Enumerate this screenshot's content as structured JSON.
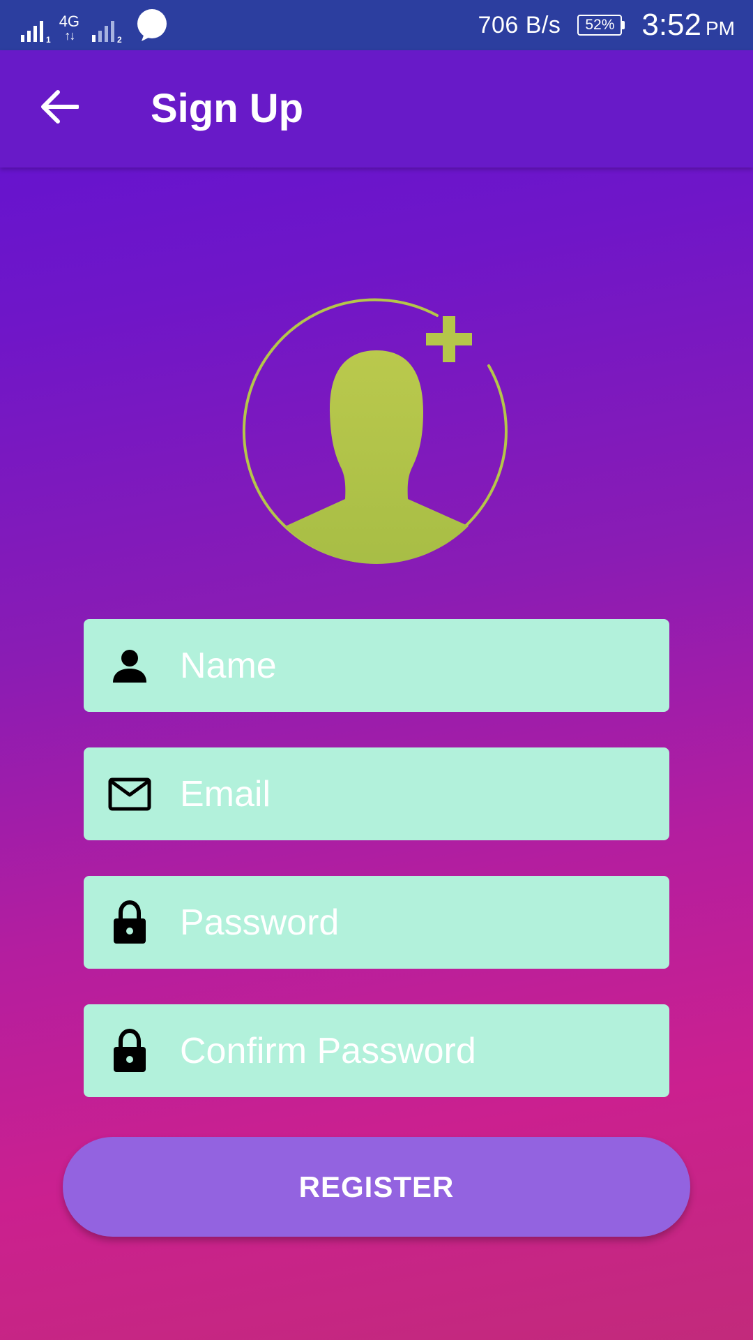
{
  "status_bar": {
    "sim1_label": "1",
    "network_type": "4G",
    "network_arrows": "↑↓",
    "sim2_label": "2",
    "net_speed": "706 B/s",
    "battery": "52%",
    "time": "3:52",
    "ampm": "PM"
  },
  "app_bar": {
    "title": "Sign Up"
  },
  "form": {
    "name_placeholder": "Name",
    "email_placeholder": "Email",
    "password_placeholder": "Password",
    "confirm_password_placeholder": "Confirm Password"
  },
  "register": {
    "label": "REGISTER"
  },
  "colors": {
    "status_bar": "#2c3e9f",
    "app_bar": "#681ac8",
    "field_background": "#b2f1db",
    "avatar_green": "#b5c64a",
    "register_button": "#9363e0"
  },
  "icons": {
    "back": "arrow-left-icon",
    "avatar": "add-user-avatar-icon",
    "name": "person-icon",
    "email": "mail-icon",
    "password": "lock-icon",
    "confirm_password": "lock-icon"
  }
}
